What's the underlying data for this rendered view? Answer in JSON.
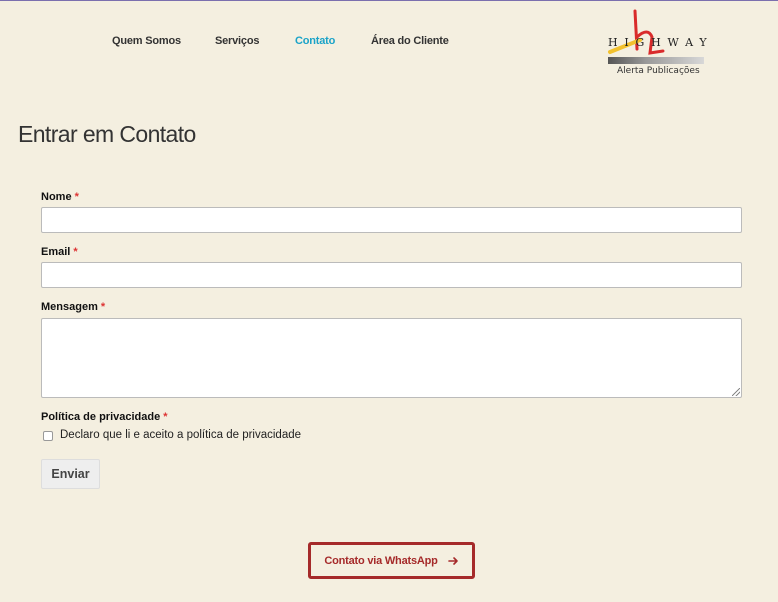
{
  "nav": {
    "items": [
      "Quem Somos",
      "Serviços",
      "Contato",
      "Área do Cliente"
    ],
    "active": "Contato"
  },
  "logo": {
    "text": "HIGHWAY",
    "subtitle": "Alerta Publicações",
    "accent_red": "#d92b2b",
    "accent_yellow": "#f2c12e"
  },
  "page": {
    "title": "Entrar em Contato"
  },
  "form": {
    "name_label": "Nome",
    "email_label": "Email",
    "message_label": "Mensagem",
    "privacy_label": "Política de privacidade",
    "required_mark": "*",
    "privacy_check": "Declaro que li e aceito a política de privacidade",
    "submit": "Enviar"
  },
  "whatsapp": {
    "label": "Contato via WhatsApp",
    "color": "#a52a2a"
  },
  "colors": {
    "background": "#f4efe0",
    "nav_active": "#1aa3c8"
  }
}
